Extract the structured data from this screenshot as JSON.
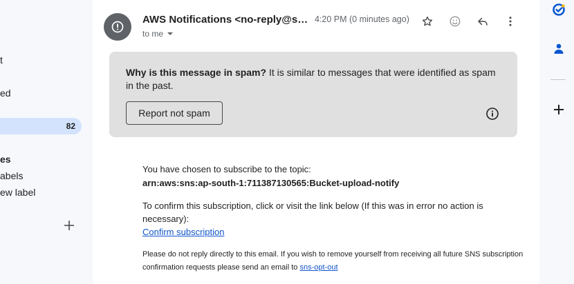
{
  "sidebar": {
    "item_1": "t",
    "item_2": "ed",
    "active_count": "82",
    "labels_heading": "es",
    "labels_item": "abels",
    "new_label": "ew label"
  },
  "message": {
    "sender": "AWS Notifications <no-reply@sns.amazonaws.com>",
    "time": "4:20 PM (0 minutes ago)",
    "recipient": "to me",
    "spam_question": "Why is this message in spam?",
    "spam_reason": "It is similar to messages that were identified as spam in the past.",
    "report_button": "Report not spam",
    "subscribe_line": "You have chosen to subscribe to the topic:",
    "topic_arn": "arn:aws:sns:ap-south-1:711387130565:Bucket-upload-notify",
    "confirm_line": "To confirm this subscription, click or visit the link below (If this was in error no action is necessary):",
    "confirm_link": "Confirm subscription",
    "footer_text": "Please do not reply directly to this email. If you wish to remove yourself from receiving all future SNS subscription confirmation requests please send an email to",
    "opt_out_link": "sns-opt-out"
  },
  "colors": {
    "spam_box": "#e0e0e0",
    "active_nav": "#d3e3fd",
    "link": "#1155cc",
    "rail_blue": "#0b57d0"
  },
  "icons": [
    "alert-circle-icon",
    "dropdown-arrow-icon",
    "star-icon",
    "emoji-icon",
    "reply-icon",
    "more-vert-icon",
    "info-icon",
    "plus-icon",
    "tasks-icon",
    "contacts-icon",
    "add-app-icon"
  ]
}
